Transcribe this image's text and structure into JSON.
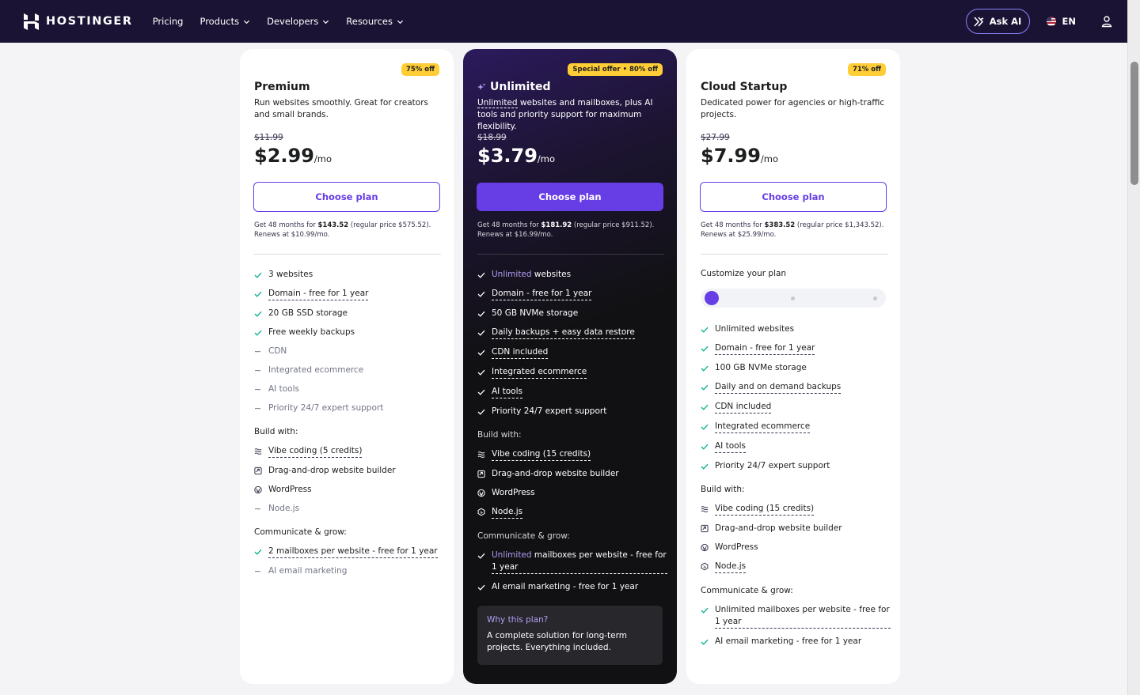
{
  "nav": {
    "brand": "HOSTINGER",
    "links": [
      {
        "label": "Pricing",
        "dropdown": false
      },
      {
        "label": "Products",
        "dropdown": true
      },
      {
        "label": "Developers",
        "dropdown": true
      },
      {
        "label": "Resources",
        "dropdown": true
      }
    ],
    "ask_ai": "Ask AI",
    "lang": "EN"
  },
  "colors": {
    "accent": "#673de6",
    "nav_bg": "#1a1334",
    "badge": "#ffcd35",
    "check": "#00b090"
  },
  "plans": [
    {
      "badge": "75% off",
      "title": "Premium",
      "desc": "Run websites smoothly. Great for creators and small brands.",
      "old_price": "$11.99",
      "price": "$2.99",
      "per": "/mo",
      "cta": "Choose plan",
      "renew_a": "Get 48 months for ",
      "renew_b": "$143.52",
      "renew_c": " (regular price $575.52). Renews at $10.99/mo.",
      "features": [
        {
          "hl": "",
          "text": "3 websites",
          "on": true,
          "u": false
        },
        {
          "hl": "",
          "text": "Domain - free for 1 year",
          "on": true,
          "u": true
        },
        {
          "hl": "",
          "text": "20 GB SSD storage",
          "on": true,
          "u": false
        },
        {
          "hl": "",
          "text": "Free weekly backups",
          "on": true,
          "u": false
        },
        {
          "hl": "",
          "text": "CDN",
          "on": false,
          "u": false
        },
        {
          "hl": "",
          "text": "Integrated ecommerce",
          "on": false,
          "u": false
        },
        {
          "hl": "",
          "text": "AI tools",
          "on": false,
          "u": false
        },
        {
          "hl": "",
          "text": "Priority 24/7 expert support",
          "on": false,
          "u": false
        }
      ],
      "build_label": "Build with:",
      "build": [
        {
          "icon": "vibe-coding-icon",
          "text": "Vibe coding (5 credits)",
          "on": true,
          "u": true
        },
        {
          "icon": "website-builder-icon",
          "text": "Drag-and-drop website builder",
          "on": true,
          "u": false
        },
        {
          "icon": "wordpress-icon",
          "text": "WordPress",
          "on": true,
          "u": false
        },
        {
          "icon": "dash-icon",
          "text": "Node.js",
          "on": false,
          "u": false
        }
      ],
      "grow_label": "Communicate & grow:",
      "grow": [
        {
          "hl": "",
          "text": "2 mailboxes per website - free for 1 year",
          "on": true,
          "u": true
        },
        {
          "hl": "",
          "text": "AI email marketing",
          "on": false,
          "u": false
        }
      ]
    },
    {
      "badge": "Special offer • 80% off",
      "title": "Unlimited",
      "desc_hl": "Unlimited",
      "desc": " websites and mailboxes, plus AI tools and priority support for maximum flexibility.",
      "old_price": "$18.99",
      "price": "$3.79",
      "per": "/mo",
      "cta": "Choose plan",
      "renew_a": "Get 48 months for ",
      "renew_b": "$181.92",
      "renew_c": " (regular price $911.52). Renews at $16.99/mo.",
      "features": [
        {
          "hl": "Unlimited",
          "text": " websites",
          "on": true,
          "u": false
        },
        {
          "hl": "",
          "text": "Domain - free for 1 year",
          "on": true,
          "u": true
        },
        {
          "hl": "",
          "text": "50 GB NVMe storage",
          "on": true,
          "u": false
        },
        {
          "hl": "",
          "text": "Daily backups + easy data restore",
          "on": true,
          "u": true
        },
        {
          "hl": "",
          "text": "CDN included",
          "on": true,
          "u": true
        },
        {
          "hl": "",
          "text": "Integrated ecommerce",
          "on": true,
          "u": true
        },
        {
          "hl": "",
          "text": "AI tools",
          "on": true,
          "u": true
        },
        {
          "hl": "",
          "text": "Priority 24/7 expert support",
          "on": true,
          "u": false
        }
      ],
      "build_label": "Build with:",
      "build": [
        {
          "icon": "vibe-coding-icon",
          "text": "Vibe coding (15 credits)",
          "on": true,
          "u": true
        },
        {
          "icon": "website-builder-icon",
          "text": "Drag-and-drop website builder",
          "on": true,
          "u": false
        },
        {
          "icon": "wordpress-icon",
          "text": "WordPress",
          "on": true,
          "u": false
        },
        {
          "icon": "nodejs-icon",
          "text": "Node.js",
          "on": true,
          "u": true
        }
      ],
      "grow_label": "Communicate & grow:",
      "grow": [
        {
          "hl": "Unlimited",
          "text": " mailboxes per website - free for 1 year",
          "on": true,
          "u": true
        },
        {
          "hl": "",
          "text": "AI email marketing - free for 1 year",
          "on": true,
          "u": false
        }
      ],
      "why_title": "Why this plan?",
      "why_desc": "A complete solution for long-term projects. Everything included."
    },
    {
      "badge": "71% off",
      "title": "Cloud Startup",
      "desc": "Dedicated power for agencies or high-traffic projects.",
      "old_price": "$27.99",
      "price": "$7.99",
      "per": "/mo",
      "cta": "Choose plan",
      "renew_a": "Get 48 months for ",
      "renew_b": "$383.52",
      "renew_c": " (regular price $1,343.52). Renews at $25.99/mo.",
      "customize": "Customize your plan",
      "slider_steps": 3,
      "slider_selected": 1,
      "features": [
        {
          "hl": "",
          "text": "Unlimited websites",
          "on": true,
          "u": false
        },
        {
          "hl": "",
          "text": "Domain - free for 1 year",
          "on": true,
          "u": true
        },
        {
          "hl": "",
          "text": "100 GB NVMe storage",
          "on": true,
          "u": false
        },
        {
          "hl": "",
          "text": "Daily and on demand backups",
          "on": true,
          "u": true
        },
        {
          "hl": "",
          "text": "CDN included",
          "on": true,
          "u": true
        },
        {
          "hl": "",
          "text": "Integrated ecommerce",
          "on": true,
          "u": true
        },
        {
          "hl": "",
          "text": "AI tools",
          "on": true,
          "u": true
        },
        {
          "hl": "",
          "text": "Priority 24/7 expert support",
          "on": true,
          "u": false
        }
      ],
      "build_label": "Build with:",
      "build": [
        {
          "icon": "vibe-coding-icon",
          "text": "Vibe coding (15 credits)",
          "on": true,
          "u": true
        },
        {
          "icon": "website-builder-icon",
          "text": "Drag-and-drop website builder",
          "on": true,
          "u": false
        },
        {
          "icon": "wordpress-icon",
          "text": "WordPress",
          "on": true,
          "u": false
        },
        {
          "icon": "nodejs-icon",
          "text": "Node.js",
          "on": true,
          "u": true
        }
      ],
      "grow_label": "Communicate & grow:",
      "grow": [
        {
          "hl": "",
          "text": "Unlimited mailboxes per website - free for 1 year",
          "on": true,
          "u": true
        },
        {
          "hl": "",
          "text": "AI email marketing - free for 1 year",
          "on": true,
          "u": false
        }
      ]
    }
  ]
}
